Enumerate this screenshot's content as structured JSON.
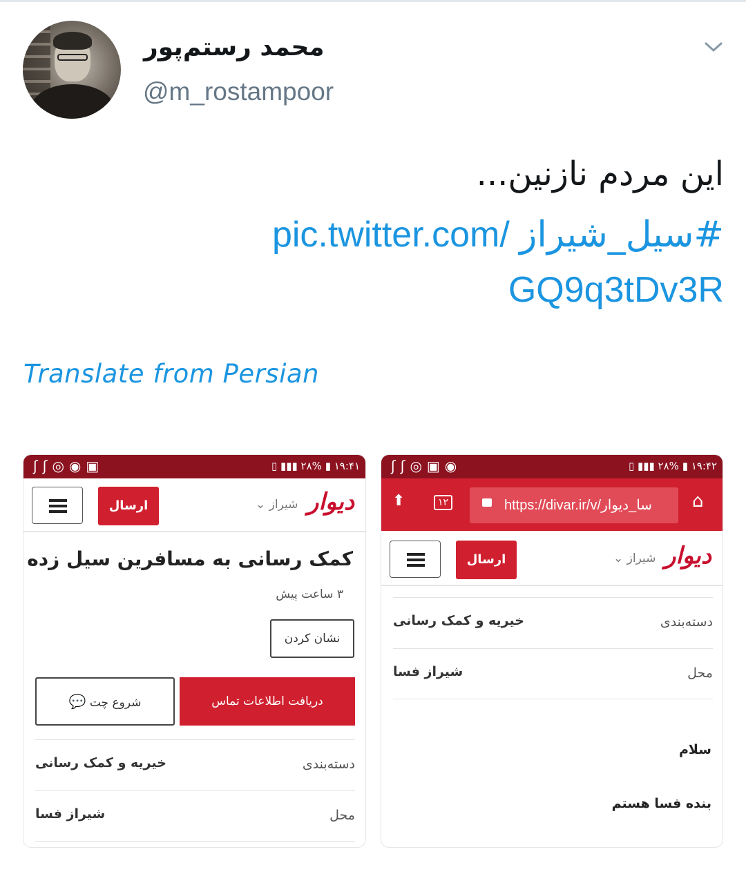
{
  "tweet": {
    "name": "محمد رستم‌پور",
    "handle": "@m_rostampoor",
    "text": "این مردم نازنین...",
    "hashtag": "#سیل_شیراز",
    "link": "pic.twitter.com/",
    "link_tail": "GQ9q3tDv3R",
    "translate_label": "Translate from Persian"
  },
  "left_shot": {
    "status_time": "۱۹:۴۱",
    "status_battery": "۲۸%",
    "app_logo": "دیوار",
    "city": "شیراز ⌄",
    "send_label": "ارسال",
    "ad_title": "کمک رسانی به مسافرین سیل زده",
    "ad_time": "۳ ساعت پیش",
    "mark_label": "نشان کردن",
    "contact_label": "دریافت اطلاعات تماس",
    "chat_label": "شروع چت",
    "rows": [
      {
        "label": "دسته‌بندی",
        "value": "خیریه و کمک رسانی"
      },
      {
        "label": "محل",
        "value": "شیراز فسا"
      }
    ]
  },
  "right_shot": {
    "status_time": "۱۹:۴۲",
    "status_battery": "۲۸%",
    "url": "https://divar.ir/v/سا_دیوار",
    "tab_count": "۱۲",
    "app_logo": "دیوار",
    "city": "شیراز ⌄",
    "send_label": "ارسال",
    "rows": [
      {
        "label": "دسته‌بندی",
        "value": "خیریه و کمک رسانی"
      },
      {
        "label": "محل",
        "value": "شیراز فسا"
      }
    ],
    "messages": [
      "سلام",
      "بنده فسا هستم"
    ]
  },
  "colors": {
    "link": "#1b95e0",
    "divar_red": "#d0202f",
    "status_bar": "#8c1220"
  }
}
